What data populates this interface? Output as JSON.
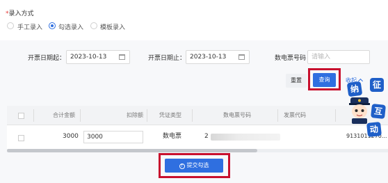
{
  "entry_mode": {
    "label": "录入方式",
    "required_mark": "*",
    "options": [
      {
        "label": "手工录入",
        "checked": false
      },
      {
        "label": "勾选录入",
        "checked": true
      },
      {
        "label": "模板录入",
        "checked": false
      }
    ]
  },
  "filters": {
    "start_date_label": "开票日期起：",
    "start_date_value": "2023-10-13",
    "end_date_label": "开票日期止：",
    "end_date_value": "2023-10-13",
    "invoice_no_label": "数电票号码",
    "invoice_no_placeholder": "请输入"
  },
  "actions": {
    "reset_label": "重置",
    "query_label": "查询",
    "collapse_label": "收起"
  },
  "table": {
    "columns": [
      "合计金额",
      "扣除额",
      "凭证类型",
      "数电票号码",
      "发票代码"
    ],
    "rows": [
      {
        "total_amount": "3000",
        "deduction": "3000",
        "voucher_type": "数电票",
        "invoice_no_prefix": "2",
        "extra_code": "9131011270..."
      }
    ]
  },
  "submit_label": "提交勾选",
  "mascot": {
    "chars": [
      "征",
      "纳",
      "互",
      "动"
    ]
  },
  "colors": {
    "primary": "#2f6fe0",
    "highlight_frame": "#c8102e",
    "panel_bg": "#f7f8fa"
  }
}
